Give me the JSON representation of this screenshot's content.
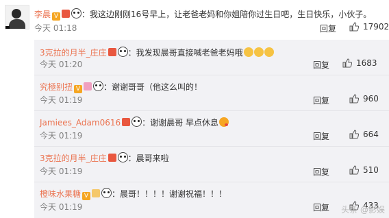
{
  "main_comment": {
    "user": "李晨",
    "text": "：我这边刚刚16号早上，让老爸老妈和你姐陪你过生日吧，生日快乐，小伙子。",
    "time": "今天 01:18",
    "reply_label": "回复",
    "likes": "17902"
  },
  "replies": [
    {
      "user": "3克拉的月半_庄庄",
      "text": "：我发现晨哥直接喊老爸老妈哦",
      "time": "今天 01:20",
      "reply_label": "回复",
      "likes": "1683"
    },
    {
      "user": "究極别扭",
      "text": "：谢谢哥哥（他这么叫的！",
      "time": "今天 01:19",
      "reply_label": "回复",
      "likes": "960"
    },
    {
      "user": "Jamiees_Adam0616",
      "text": "：谢谢晨哥 早点休息",
      "time": "今天 01:19",
      "reply_label": "回复",
      "likes": "664"
    },
    {
      "user": "3克拉的月半_庄庄",
      "text": "：晨哥来啦",
      "time": "今天 01:19",
      "reply_label": "回复",
      "likes": "510"
    },
    {
      "user": "橙味水果糖",
      "text": "：晨哥！！！！谢谢祝福！！！",
      "time": "今天 01:19",
      "reply_label": "回复",
      "likes": "433"
    }
  ],
  "watermark": "头条 @影娱",
  "colors": {
    "username": "#eb7350",
    "reply_bg": "#f2f2f5",
    "time": "#808080"
  }
}
